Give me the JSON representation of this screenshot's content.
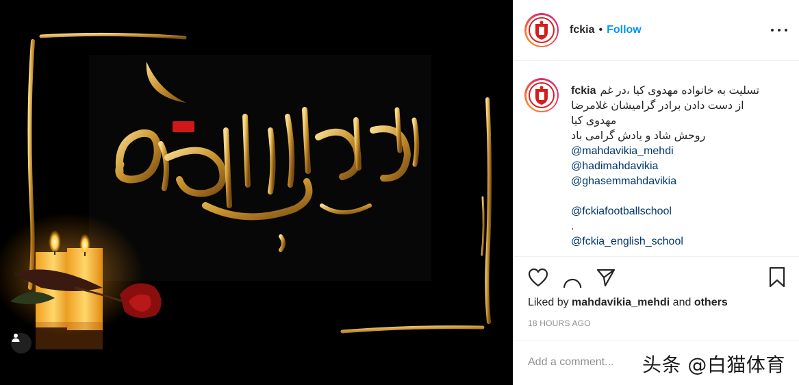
{
  "post": {
    "username": "fckia",
    "header_separator": "•",
    "follow_label": "Follow",
    "more_icon": "more-horizontal-icon",
    "caption": {
      "author": "fckia",
      "lines": [
        "تسلیت به خانواده مهدوی کیا ،در غم",
        "از دست دادن برادر گرامیشان غلامرضا",
        "مهدوی کیا",
        "روحش شاد و یادش گرامی باد"
      ],
      "mentions_a": [
        "@mahdavikia_mehdi",
        "@hadimahdavikia",
        "@ghasemmahdavikia"
      ],
      "mention_school": "@fckiafootballschool",
      "dot_line": ".",
      "mention_english": "@fckia_english_school"
    },
    "likes": {
      "prefix": "Liked by",
      "user": "mahdavikia_mehdi",
      "connector": "and",
      "others": "others"
    },
    "timestamp": "18 HOURS AGO",
    "comment_placeholder": "Add a comment...",
    "watermark": "头条 @白猫体育"
  },
  "icons": [
    "heart-icon",
    "comment-icon",
    "share-icon",
    "bookmark-icon",
    "user-tag-icon"
  ],
  "colors": {
    "follow": "#0095f6",
    "mention": "#00376b",
    "meta": "#8e8e8e",
    "media_bg": "#000000",
    "gold": "#c89a3c"
  }
}
